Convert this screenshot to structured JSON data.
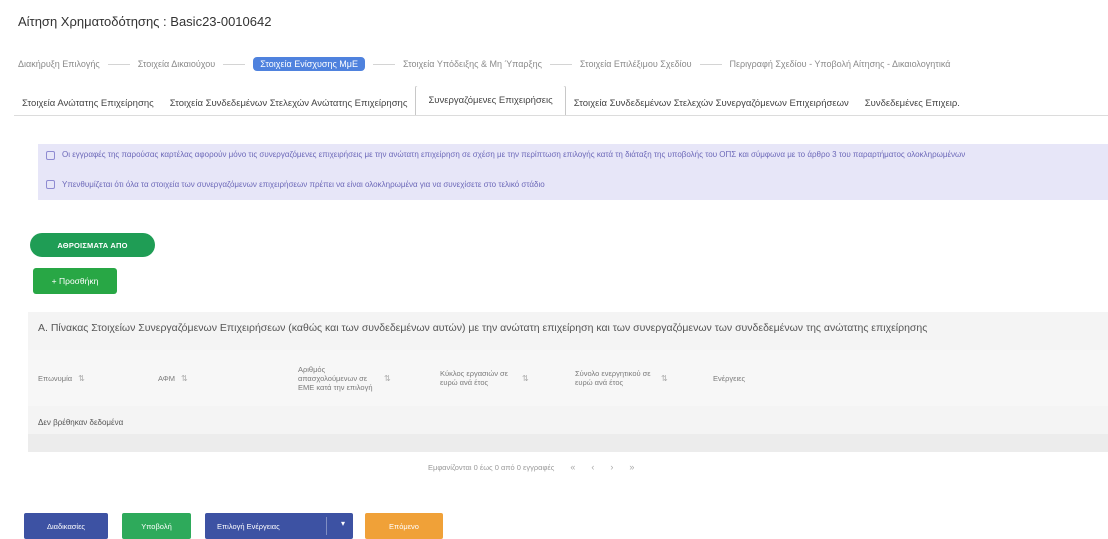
{
  "page": {
    "title": "Αίτηση Χρηματοδότησης : Basic23-0010642"
  },
  "steps": [
    {
      "label": "Διακήρυξη Επιλογής",
      "active": false
    },
    {
      "label": "Στοιχεία Δικαιούχου",
      "active": false
    },
    {
      "label": "Στοιχεία Ενίσχυσης ΜμΕ",
      "active": true
    },
    {
      "label": "Στοιχεία Υπόδειξης & Μη Ύπαρξης",
      "active": false
    },
    {
      "label": "Στοιχεία Επιλέξιμου Σχεδίου",
      "active": false
    },
    {
      "label": "Περιγραφή Σχεδίου - Υποβολή Αίτησης - Δικαιολογητικά",
      "active": false
    }
  ],
  "subtabs": [
    {
      "label": "Στοιχεία Ανώτατης Επιχείρησης",
      "active": false
    },
    {
      "label": "Στοιχεία Συνδεδεμένων Στελεχών Ανώτατης Επιχείρησης",
      "active": false
    },
    {
      "label": "Συνεργαζόμενες Επιχειρήσεις",
      "active": true
    },
    {
      "label": "Στοιχεία Συνδεδεμένων Στελεχών Συνεργαζόμενων Επιχειρήσεων",
      "active": false
    },
    {
      "label": "Συνδεδεμένες Επιχειρ.",
      "active": false
    }
  ],
  "info": {
    "line1": "Οι εγγραφές της παρούσας καρτέλας αφορούν μόνο τις συνεργαζόμενες επιχειρήσεις με την ανώτατη επιχείρηση σε σχέση με την περίπτωση επιλογής κατά τη διάταξη της υποβολής του ΟΠΣ και σύμφωνα με το άρθρο 3 του παραρτήματος ολοκληρωμένων",
    "line2": "Υπενθυμίζεται ότι όλα τα στοιχεία των συνεργαζόμενων επιχειρήσεων πρέπει να είναι ολοκληρωμένα για να συνεχίσετε στο τελικό στάδιο"
  },
  "buttons": {
    "aggregations": "ΑΘΡΟΙΣΜΑΤΑ ΑΠΟ",
    "add": "+ Προσθήκη",
    "cancel": "Διαδικασίες",
    "previous": "Υποβολή",
    "choose": "Επιλογή Ενέργειας",
    "next": "Επόμενο"
  },
  "table": {
    "heading": "Α. Πίνακας Στοιχείων Συνεργαζόμενων Επιχειρήσεων (καθώς και των συνδεδεμένων αυτών) με την ανώτατη επιχείρηση και των συνεργαζόμενων των συνδεδεμένων της ανώτατης επιχείρησης",
    "columns": [
      "Επωνυμία",
      "ΑΦΜ",
      "Αριθμός απασχολούμενων σε ΕΜΕ κατά την επιλογή",
      "Κύκλος εργασιών σε ευρώ ανά έτος",
      "Σύνολο ενεργητικού σε ευρώ ανά έτος",
      "Ενέργειες"
    ],
    "empty_text": "Δεν βρέθηκαν δεδομένα",
    "pager_text": "Εμφανίζονται 0 έως 0 από 0 εγγραφές"
  },
  "icons": {
    "info": "info-square-icon",
    "sort": "sort-arrows-icon",
    "caret": "chevron-down-icon"
  },
  "colors": {
    "accent_blue": "#4f82de",
    "primary": "#3d52a3",
    "success": "#28a745",
    "warning": "#f0a138",
    "info_bg": "#e7e6f8"
  }
}
